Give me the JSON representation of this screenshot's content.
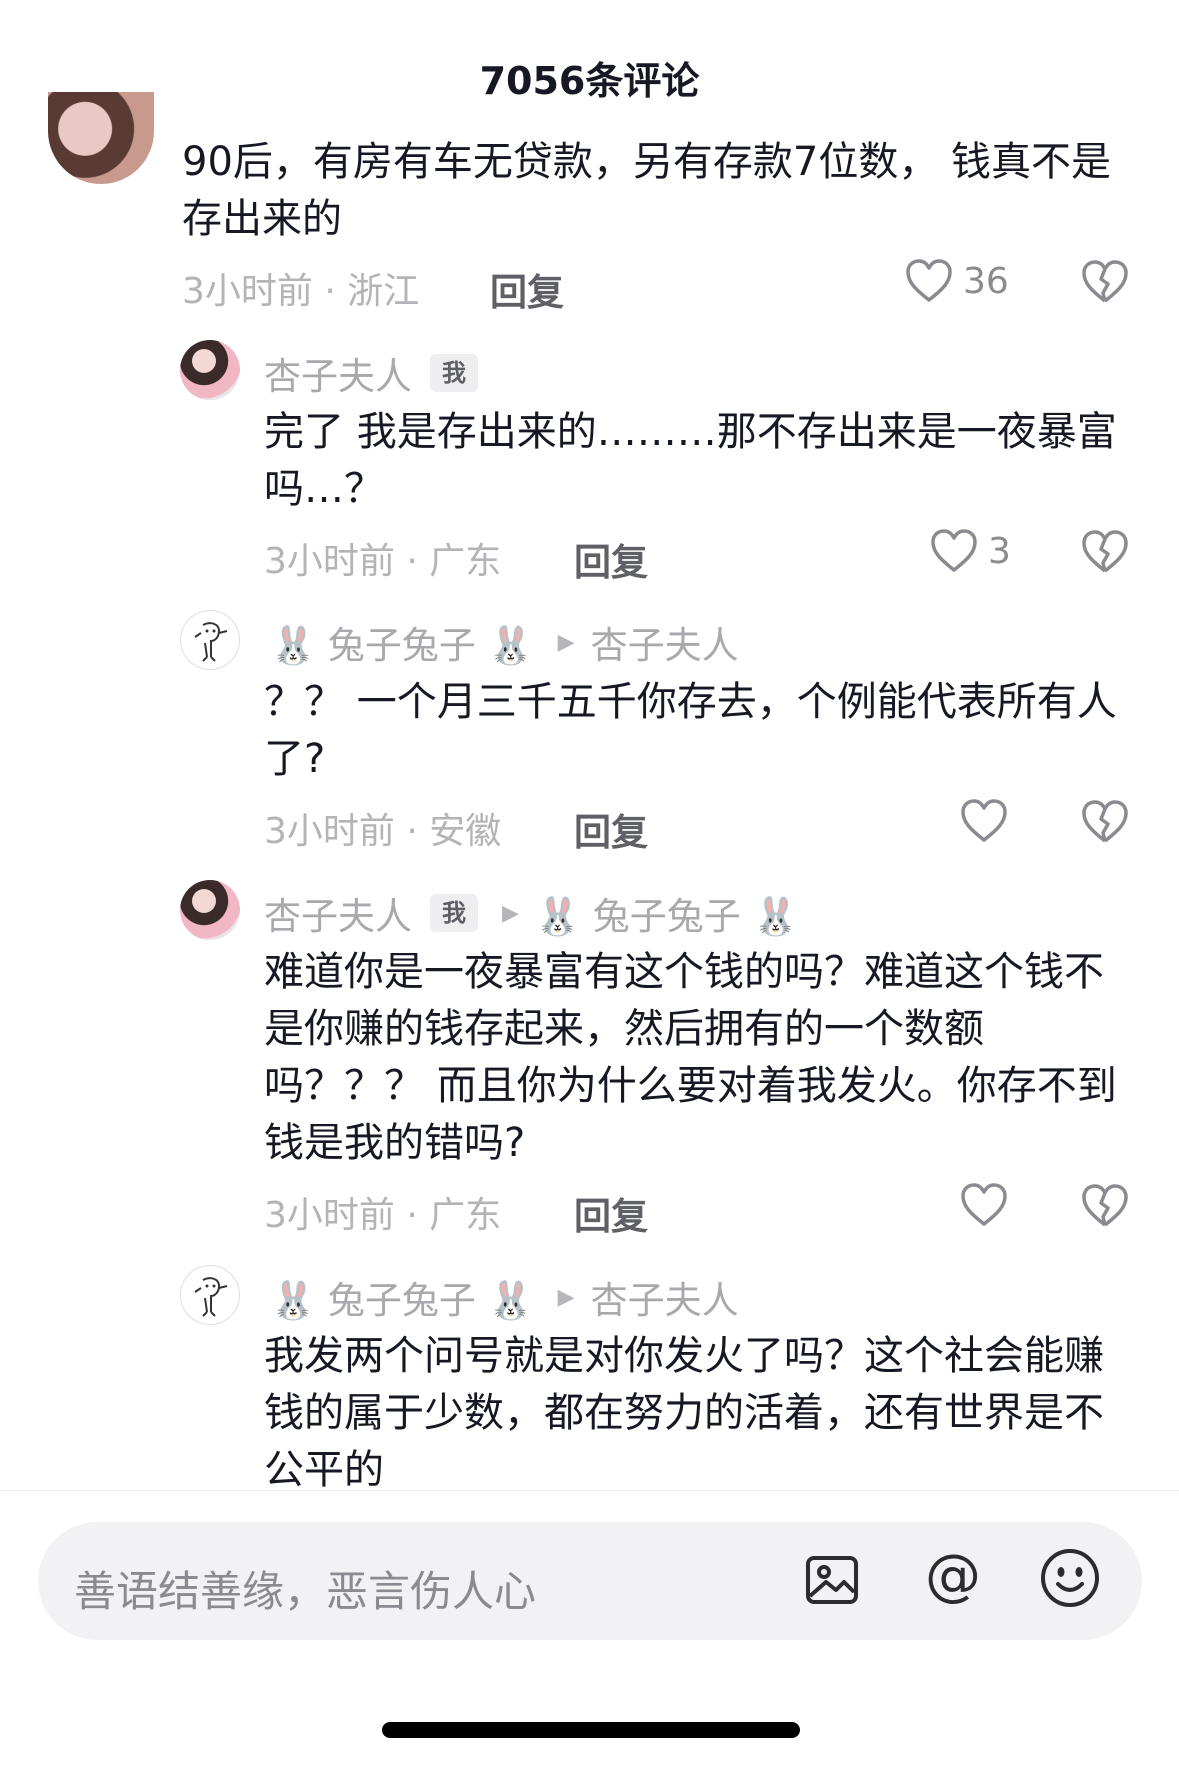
{
  "header": {
    "title": "7056条评论"
  },
  "comments": [
    {
      "text": "90后，有房有车无贷款，另有存款7位数，  钱真不是存出来的",
      "meta": "3小时前 · 浙江",
      "reply_label": "回复",
      "likes": "36"
    },
    {
      "author": "杏子夫人",
      "me_badge": "我",
      "text": "完了 我是存出来的………那不存出来是一夜暴富吗…？",
      "meta": "3小时前 · 广东",
      "reply_label": "回复",
      "likes": "3"
    },
    {
      "author": "🐰 兔子兔子 🐰",
      "reply_to": "杏子夫人",
      "text": "？？ 一个月三千五千你存去，个例能代表所有人了?",
      "meta": "3小时前 · 安徽",
      "reply_label": "回复",
      "likes": ""
    },
    {
      "author": "杏子夫人",
      "me_badge": "我",
      "reply_to": "🐰 兔子兔子 🐰",
      "text": "难道你是一夜暴富有这个钱的吗？难道这个钱不是你赚的钱存起来，然后拥有的一个数额吗？？？  而且你为什么要对着我发火。你存不到钱是我的错吗?",
      "meta": "3小时前 · 广东",
      "reply_label": "回复",
      "likes": ""
    },
    {
      "author": "🐰 兔子兔子 🐰",
      "reply_to": "杏子夫人",
      "text": "我发两个问号就是对你发火了吗？这个社会能赚钱的属于少数，都在努力的活着，还有世界是不公平的"
    }
  ],
  "input": {
    "placeholder": "善语结善缘，恶言伤人心"
  },
  "icons": {
    "like": "heart-outline-icon",
    "dislike": "broken-heart-icon",
    "image": "image-icon",
    "mention": "at-icon",
    "emoji": "smiley-icon"
  }
}
